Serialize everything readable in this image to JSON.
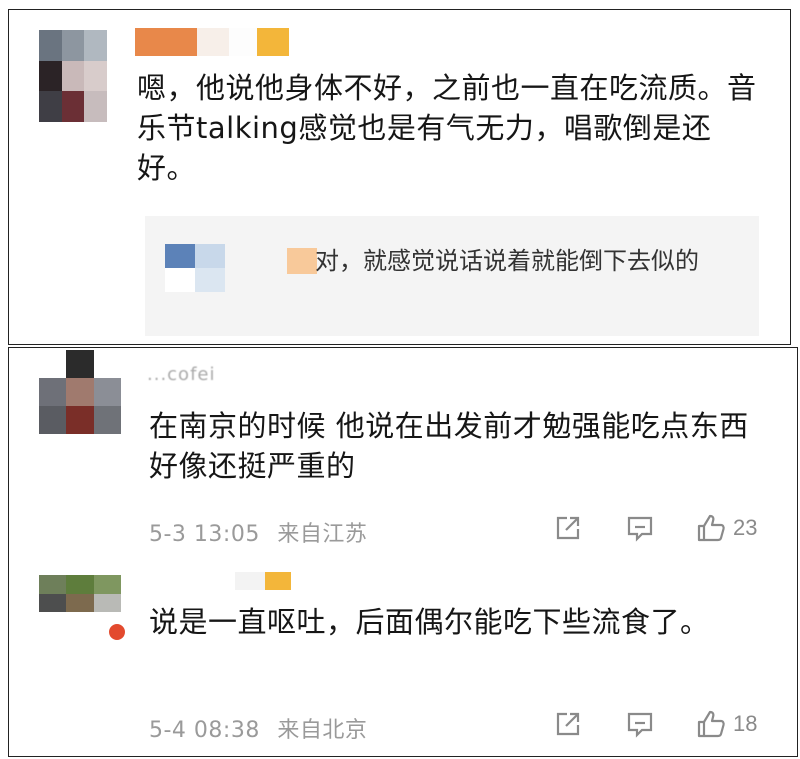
{
  "comments": [
    {
      "text": "嗯，他说他身体不好，之前也一直在吃流质。音乐节talking感觉也是有气无力，唱歌倒是还好。",
      "reply": {
        "text": "对，就感觉说话说着就能倒下去似的"
      }
    },
    {
      "username_fragment": "...cofei",
      "text": "在南京的时候 他说在出发前才勉强能吃点东西 好像还挺严重的",
      "date": "5-3 13:05",
      "location": "来自江苏",
      "likes": "23"
    },
    {
      "text": "说是一直呕吐，后面偶尔能吃下些流食了。",
      "date": "5-4 08:38",
      "location": "来自北京",
      "likes": "18"
    }
  ],
  "icons": {
    "share": "share-icon",
    "comment": "comment-icon",
    "like": "thumbs-up-icon"
  },
  "colors": {
    "meta_text": "#9a9a9a",
    "reply_bg": "#f4f4f4",
    "border": "#222222"
  }
}
